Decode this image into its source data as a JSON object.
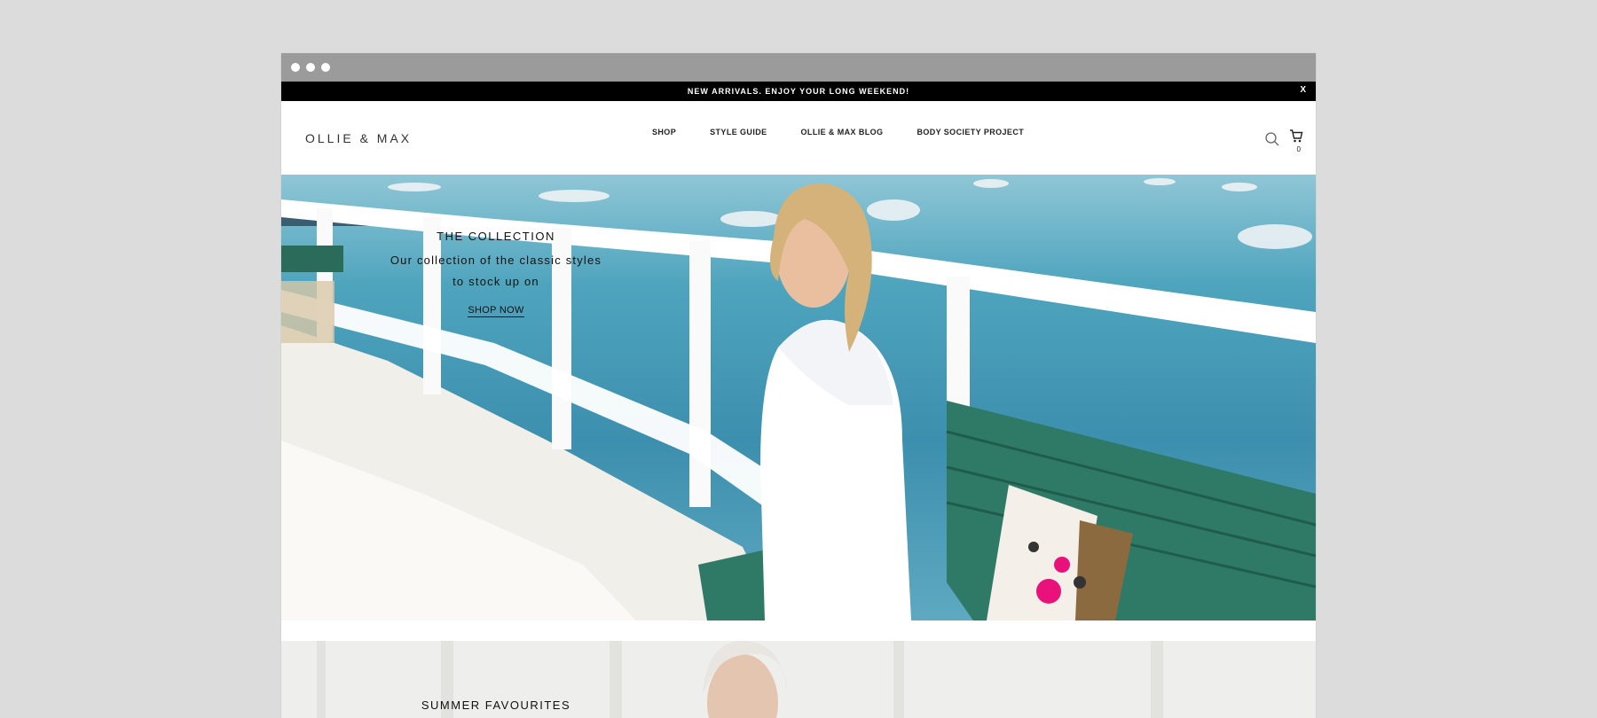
{
  "announcement": {
    "text": "NEW ARRIVALS. ENJOY YOUR LONG WEEKEND!",
    "close_label": "X"
  },
  "header": {
    "logo": "OLLIE & MAX",
    "nav": [
      "SHOP",
      "STYLE GUIDE",
      "OLLIE & MAX BLOG",
      "BODY SOCIETY PROJECT"
    ],
    "cart_count": "0",
    "icons": [
      "search-icon",
      "cart-icon"
    ]
  },
  "hero": {
    "title": "THE COLLECTION",
    "subtitle_line1": "Our collection of the classic styles",
    "subtitle_line2": "to stock up on",
    "cta": "SHOP NOW"
  },
  "section2": {
    "title": "SUMMER FAVOURITES"
  },
  "colors": {
    "announce_bg": "#000000",
    "titlebar": "#9b9b9b",
    "page_bg": "#dcdcdc",
    "water": "#3c8fae"
  }
}
